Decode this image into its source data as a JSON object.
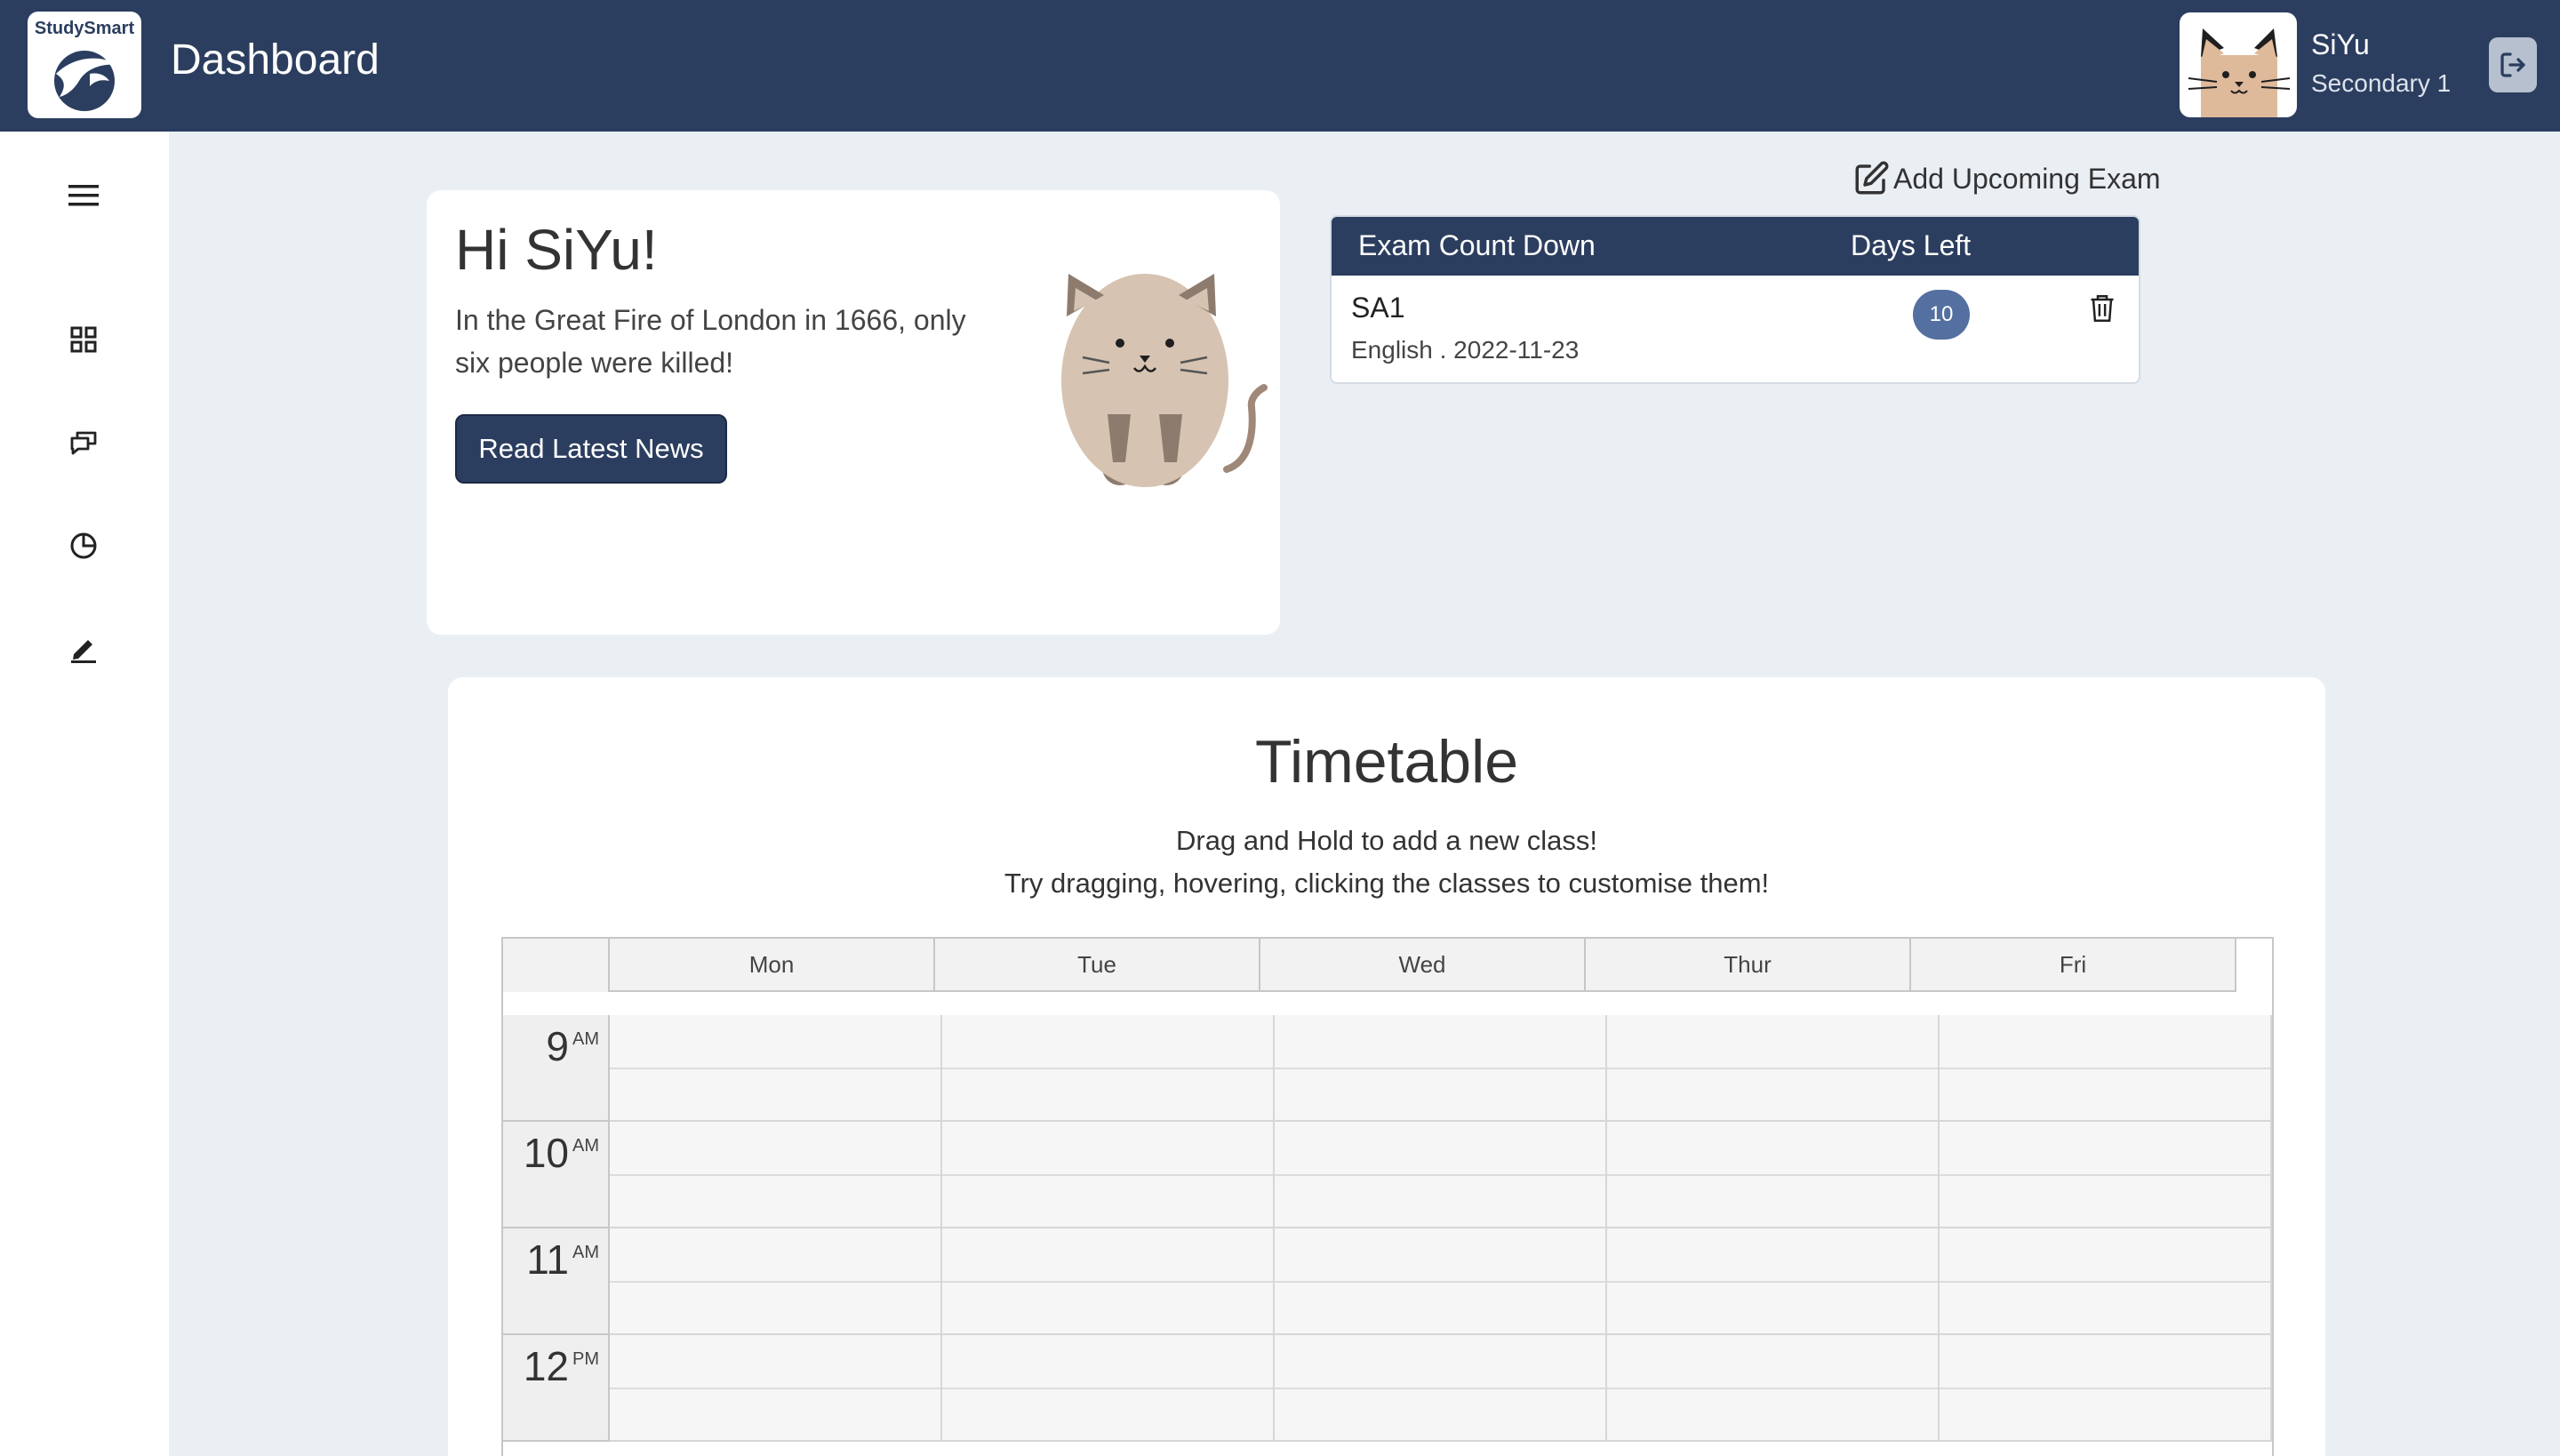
{
  "header": {
    "brand": "StudySmart",
    "title": "Dashboard",
    "user": {
      "name": "SiYu",
      "level": "Secondary 1"
    }
  },
  "sidebar": {
    "icons": [
      "menu-icon",
      "dashboard-icon",
      "chat-icon",
      "pie-chart-icon",
      "edit-icon"
    ]
  },
  "greeting": {
    "title": "Hi SiYu!",
    "fact": "In the Great Fire of London in 1666, only six people were killed!",
    "button": "Read Latest News"
  },
  "exams": {
    "add_label": "Add Upcoming Exam",
    "headers": {
      "name": "Exam Count Down",
      "days": "Days Left"
    },
    "items": [
      {
        "name": "SA1",
        "detail": "English . 2022-11-23",
        "days_left": "10"
      }
    ]
  },
  "timetable": {
    "title": "Timetable",
    "hint_line1": "Drag and Hold to add a new class!",
    "hint_line2": "Try dragging, hovering, clicking the classes to customise them!",
    "days": [
      "Mon",
      "Tue",
      "Wed",
      "Thur",
      "Fri"
    ],
    "hours": [
      {
        "num": "9",
        "ampm": "AM"
      },
      {
        "num": "10",
        "ampm": "AM"
      },
      {
        "num": "11",
        "ampm": "AM"
      },
      {
        "num": "12",
        "ampm": "PM"
      }
    ]
  },
  "colors": {
    "navy": "#2c3e5f",
    "badge": "#5470a0",
    "background": "#eaeff4"
  }
}
